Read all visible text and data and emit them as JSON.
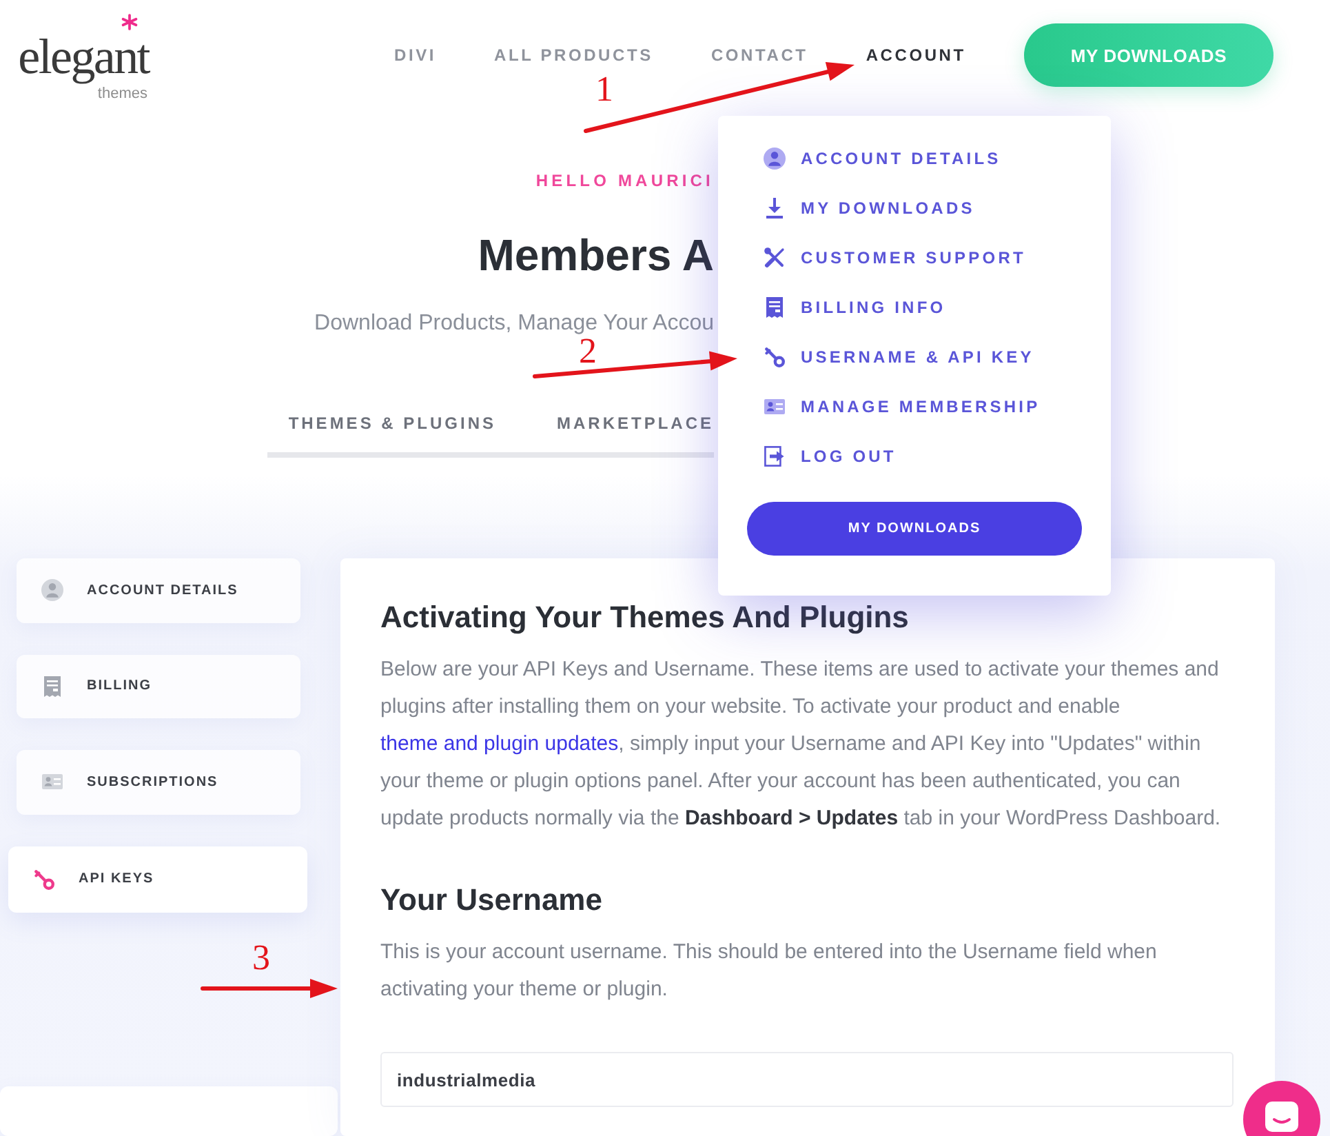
{
  "header": {
    "logo": {
      "wordmark": "elegant",
      "tagline": "themes"
    },
    "nav": [
      {
        "label": "DIVI",
        "selected": false
      },
      {
        "label": "ALL PRODUCTS",
        "selected": false
      },
      {
        "label": "CONTACT",
        "selected": false
      },
      {
        "label": "ACCOUNT",
        "selected": true
      }
    ],
    "cta": "MY DOWNLOADS"
  },
  "hero": {
    "greeting": "HELLO MAURICI",
    "title": "Members A",
    "subtitle": "Download Products, Manage Your Accou",
    "tabs": [
      {
        "label": "THEMES & PLUGINS"
      },
      {
        "label": "MARKETPLACE"
      }
    ]
  },
  "account_menu": {
    "items": [
      {
        "kind": "account",
        "label": "ACCOUNT DETAILS"
      },
      {
        "kind": "download",
        "label": "MY DOWNLOADS"
      },
      {
        "kind": "support",
        "label": "CUSTOMER SUPPORT"
      },
      {
        "kind": "billing",
        "label": "BILLING INFO"
      },
      {
        "kind": "key",
        "label": "USERNAME & API KEY"
      },
      {
        "kind": "membership",
        "label": "MANAGE MEMBERSHIP"
      },
      {
        "kind": "logout",
        "label": "LOG OUT"
      }
    ],
    "button": "MY DOWNLOADS"
  },
  "sidebar": {
    "items": [
      {
        "kind": "account",
        "label": "ACCOUNT DETAILS",
        "selected": false
      },
      {
        "kind": "billing",
        "label": "BILLING",
        "selected": false
      },
      {
        "kind": "membership",
        "label": "SUBSCRIPTIONS",
        "selected": false
      },
      {
        "kind": "key",
        "label": "API KEYS",
        "selected": true
      }
    ]
  },
  "content": {
    "sections": [
      {
        "heading": "Activating Your Themes And Plugins",
        "paragraph": {
          "before": "Below are your API Keys and Username. These items are used to activate your themes and plugins after installing them on your website. To activate your product and enable",
          "link": "theme and plugin updates",
          "after": ", simply input your Username and API Key into \"Updates\" within your theme or plugin options panel. After your account has been authenticated, you can update products normally via the **Dashboard > Updates** tab in your WordPress Dashboard."
        }
      },
      {
        "heading": "Your Username",
        "paragraph": {
          "before": "This is your account username. This should be entered into the Username field when activating your theme or plugin."
        },
        "field": {
          "value": "industrialmedia"
        }
      }
    ]
  },
  "annotations": [
    {
      "number": "1"
    },
    {
      "number": "2"
    },
    {
      "number": "3"
    }
  ]
}
